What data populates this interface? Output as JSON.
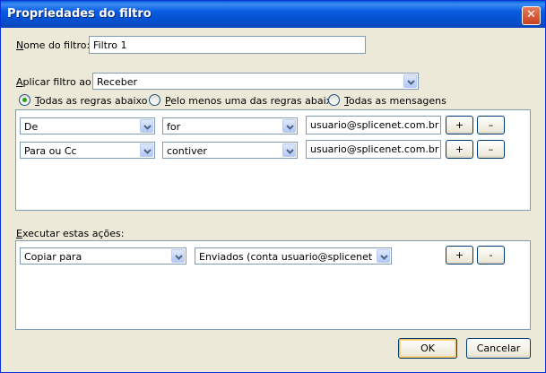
{
  "window": {
    "title": "Propriedades do filtro",
    "close_glyph": "✕"
  },
  "name": {
    "label_access": "N",
    "label_rest": "ome do filtro:",
    "value": "Filtro 1"
  },
  "apply": {
    "label_access": "A",
    "label_rest": "plicar filtro ao:",
    "value": "Receber"
  },
  "radios": [
    {
      "access": "T",
      "rest": "odas as regras abaixo",
      "selected": true
    },
    {
      "access": "P",
      "rest": "elo menos uma das regras abaixo",
      "selected": false
    },
    {
      "access": "T",
      "rest": "odas as mensagens",
      "selected": false
    }
  ],
  "rules": [
    {
      "field": "De",
      "condition": "for",
      "value": "usuario@splicenet.com.br",
      "add": "+",
      "remove": "–"
    },
    {
      "field": "Para ou Cc",
      "condition": "contiver",
      "value": "usuario@splicenet.com.br",
      "add": "+",
      "remove": "–"
    }
  ],
  "actions_label": {
    "access": "E",
    "rest": "xecutar estas ações:"
  },
  "actions": [
    {
      "action": "Copiar para",
      "target": "Enviados (conta usuario@splicenet.co...",
      "add": "+",
      "remove": "-"
    }
  ],
  "buttons": {
    "ok": "OK",
    "cancel": "Cancelar"
  }
}
